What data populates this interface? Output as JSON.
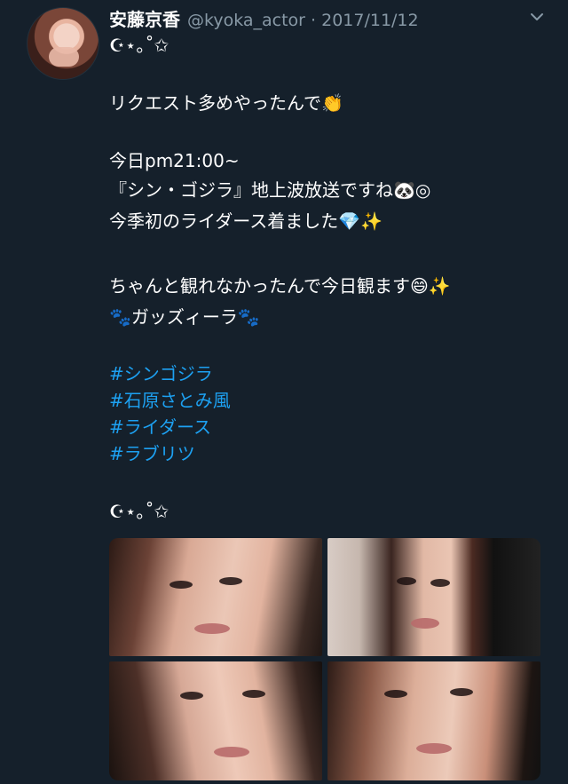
{
  "tweet": {
    "author_name": "安藤京香",
    "author_handle_date": "@kyoka_actor · 2017/11/12",
    "lines": [
      "☪︎⋆｡˚✩",
      "リクエスト多めやったんで👏",
      "今日pm21:00~",
      "『シン・ゴジラ』地上波放送ですね🐼◎",
      "今季初のライダース着ました💎✨",
      "ちゃんと観れなかったんで今日観ます😄✨",
      "🐾ガッズィーラ🐾",
      "☪︎⋆｡˚✩"
    ],
    "hashtags": [
      "#シンゴジラ",
      "#石原さとみ風",
      "#ライダース",
      "#ラブリツ"
    ]
  },
  "icons": {
    "menu": "chevron-down-icon"
  },
  "colors": {
    "background": "#15202b",
    "text": "#ffffff",
    "muted": "#8899a6",
    "link": "#1da1f2"
  }
}
